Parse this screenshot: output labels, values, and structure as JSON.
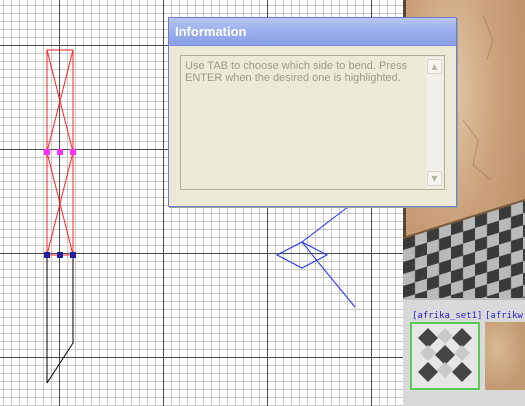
{
  "info_dialog": {
    "title": "Information",
    "message": "Use TAB to choose which side to bend. Press ENTER when the desired one is highlighted."
  },
  "texture_browser": {
    "items": [
      {
        "label": "[afrika_set1]"
      },
      {
        "label": "[afrikw"
      }
    ]
  },
  "colors": {
    "selected_brush": "#ff2020",
    "edge_handle": "#ff30ff",
    "vertex_handle": "#2020a0",
    "camera": "#2030ff",
    "brush": "#000000",
    "texture_selected": "#55cc55",
    "dialog_title": "#9db0ee"
  },
  "icons": {
    "scroll_up": "▲",
    "scroll_down": "▼"
  }
}
